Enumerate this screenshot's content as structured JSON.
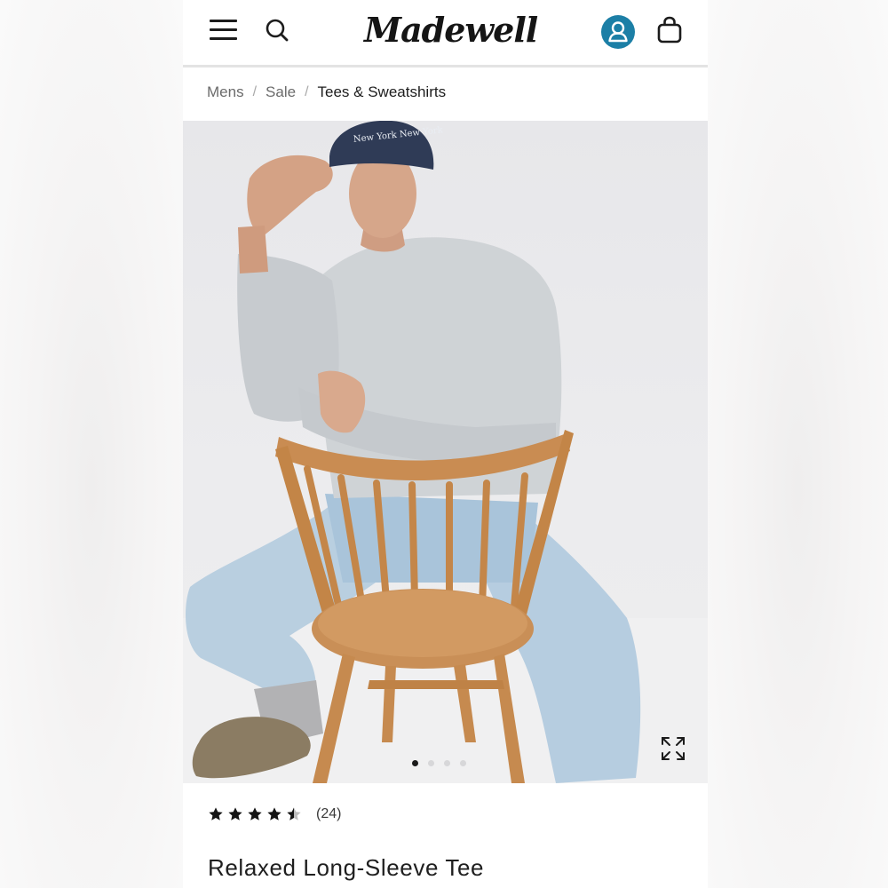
{
  "header": {
    "logo_text": "Madewell",
    "menu_icon": "hamburger-menu-icon",
    "search_icon": "search-icon",
    "account_icon": "account-icon",
    "bag_icon": "shopping-bag-icon",
    "account_color": "#1c7fa6"
  },
  "breadcrumb": {
    "items": [
      "Mens",
      "Sale",
      "Tees & Sweatshirts"
    ],
    "separator": "/"
  },
  "gallery": {
    "total_images": 4,
    "active_index": 0,
    "expand_icon": "expand-icon",
    "cap_text": "New York New York"
  },
  "product": {
    "rating": 4.5,
    "rating_max": 5,
    "review_count": "(24)",
    "title": "Relaxed Long-Sleeve Tee"
  }
}
